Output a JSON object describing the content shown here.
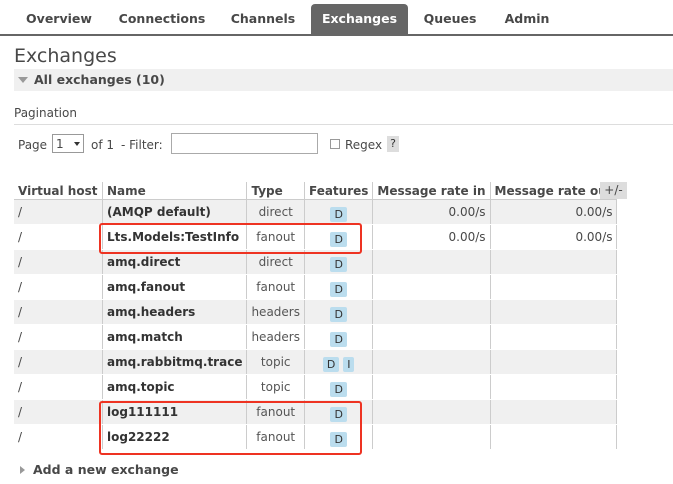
{
  "nav": {
    "tabs": [
      "Overview",
      "Connections",
      "Channels",
      "Exchanges",
      "Queues",
      "Admin"
    ],
    "active": "Exchanges"
  },
  "page": {
    "title": "Exchanges",
    "section": "All exchanges (10)",
    "pagination_label": "Pagination"
  },
  "pagination": {
    "page_label": "Page",
    "page_value": "1",
    "of_label": "of 1",
    "filter_label": "- Filter:",
    "filter_value": "",
    "regex_label": "Regex",
    "help_label": "?"
  },
  "table": {
    "columns": [
      "Virtual host",
      "Name",
      "Type",
      "Features",
      "Message rate in",
      "Message rate out"
    ],
    "plus_minus": "+/-",
    "rows": [
      {
        "vhost": "/",
        "name": "(AMQP default)",
        "type": "direct",
        "features": [
          "D"
        ],
        "rate_in": "0.00/s",
        "rate_out": "0.00/s"
      },
      {
        "vhost": "/",
        "name": "Lts.Models:TestInfo",
        "type": "fanout",
        "features": [
          "D"
        ],
        "rate_in": "0.00/s",
        "rate_out": "0.00/s"
      },
      {
        "vhost": "/",
        "name": "amq.direct",
        "type": "direct",
        "features": [
          "D"
        ],
        "rate_in": "",
        "rate_out": ""
      },
      {
        "vhost": "/",
        "name": "amq.fanout",
        "type": "fanout",
        "features": [
          "D"
        ],
        "rate_in": "",
        "rate_out": ""
      },
      {
        "vhost": "/",
        "name": "amq.headers",
        "type": "headers",
        "features": [
          "D"
        ],
        "rate_in": "",
        "rate_out": ""
      },
      {
        "vhost": "/",
        "name": "amq.match",
        "type": "headers",
        "features": [
          "D"
        ],
        "rate_in": "",
        "rate_out": ""
      },
      {
        "vhost": "/",
        "name": "amq.rabbitmq.trace",
        "type": "topic",
        "features": [
          "D",
          "I"
        ],
        "rate_in": "",
        "rate_out": ""
      },
      {
        "vhost": "/",
        "name": "amq.topic",
        "type": "topic",
        "features": [
          "D"
        ],
        "rate_in": "",
        "rate_out": ""
      },
      {
        "vhost": "/",
        "name": "log111111",
        "type": "fanout",
        "features": [
          "D"
        ],
        "rate_in": "",
        "rate_out": ""
      },
      {
        "vhost": "/",
        "name": "log22222",
        "type": "fanout",
        "features": [
          "D"
        ],
        "rate_in": "",
        "rate_out": ""
      }
    ]
  },
  "add_exchange": {
    "label": "Add a new exchange"
  },
  "colors": {
    "highlight": "#ee3322",
    "active_tab": "#666666",
    "badge": "#bbddee",
    "row_alt": "#f0f0f0"
  }
}
